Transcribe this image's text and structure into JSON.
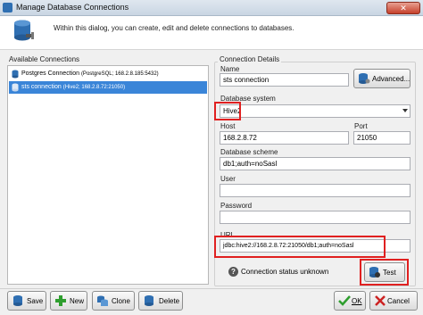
{
  "window": {
    "title": "Manage Database Connections",
    "close_glyph": "✕"
  },
  "header": {
    "intro": "Within this dialog, you can create, edit and delete connections to databases."
  },
  "left": {
    "group_label": "Available Connections",
    "connections": [
      {
        "name": "Postgres Connection",
        "detail": "(PostgreSQL; 168.2.8.185:5432)"
      },
      {
        "name": "sts connection",
        "detail": "(Hive2; 168.2.8.72:21050)"
      }
    ]
  },
  "details": {
    "group_label": "Connection Details",
    "name_label": "Name",
    "name_value": "sts connection",
    "advanced_label": "Advanced...",
    "dbsystem_label": "Database system",
    "dbsystem_value": "Hive2",
    "host_label": "Host",
    "host_value": "168.2.8.72",
    "port_label": "Port",
    "port_value": "21050",
    "scheme_label": "Database scheme",
    "scheme_value": "db1;auth=noSasl",
    "user_label": "User",
    "user_value": "",
    "password_label": "Password",
    "password_value": "",
    "url_label": "URL",
    "url_value": "jdbc:hive2://168.2.8.72:21050/db1;auth=noSasl",
    "status_text": "Connection status unknown",
    "status_glyph": "?",
    "test_label": "Test"
  },
  "footer": {
    "save_label": "Save",
    "new_label": "New",
    "clone_label": "Clone",
    "delete_label": "Delete",
    "ok_label": "OK",
    "cancel_label": "Cancel"
  },
  "colors": {
    "selection": "#3a85d8",
    "highlight": "#e02020",
    "ok_green": "#2e9e2e",
    "cancel_red": "#cc2222"
  }
}
